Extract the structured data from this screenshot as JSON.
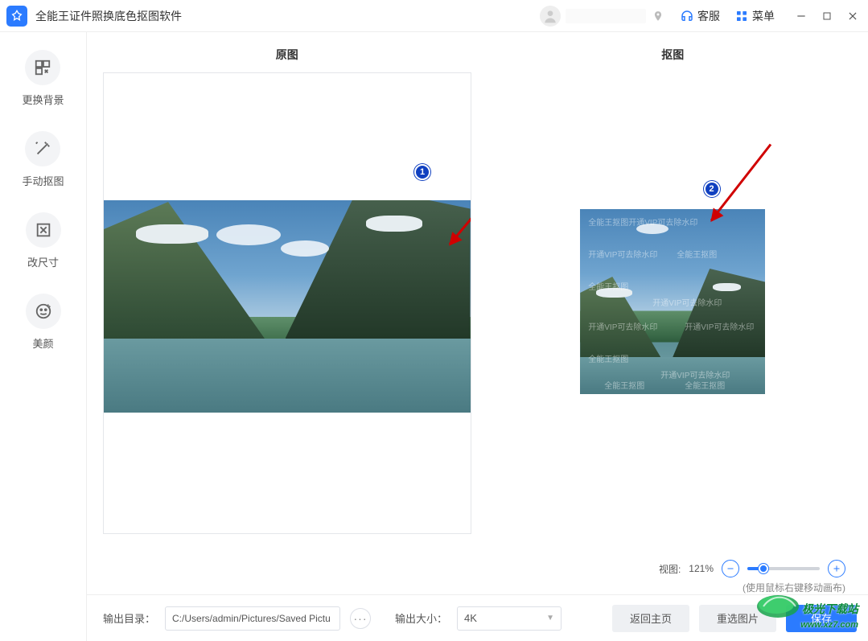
{
  "app": {
    "title": "全能王证件照换底色抠图软件"
  },
  "header": {
    "support_label": "客服",
    "menu_label": "菜单"
  },
  "sidebar": {
    "items": [
      {
        "label": "更换背景",
        "icon": "background-icon"
      },
      {
        "label": "手动抠图",
        "icon": "wand-icon"
      },
      {
        "label": "改尺寸",
        "icon": "resize-icon"
      },
      {
        "label": "美颜",
        "icon": "beauty-icon"
      }
    ]
  },
  "panels": {
    "original_title": "原图",
    "cutout_title": "抠图"
  },
  "annotations": {
    "badge1": "1",
    "badge2": "2"
  },
  "watermark": {
    "line1": "全能王抠图",
    "line2": "开通VIP可去除水印"
  },
  "view": {
    "label": "视图:",
    "value": "121%",
    "hint": "(使用鼠标右键移动画布)"
  },
  "bottom": {
    "outdir_label": "输出目录：",
    "outdir_value": "C:/Users/admin/Pictures/Saved Pictu",
    "outsize_label": "输出大小：",
    "outsize_value": "4K",
    "back_label": "返回主页",
    "reselect_label": "重选图片",
    "save_label": "保存"
  },
  "corner": {
    "site_label": "极光下载站",
    "site_url": "www.xz7.com"
  }
}
